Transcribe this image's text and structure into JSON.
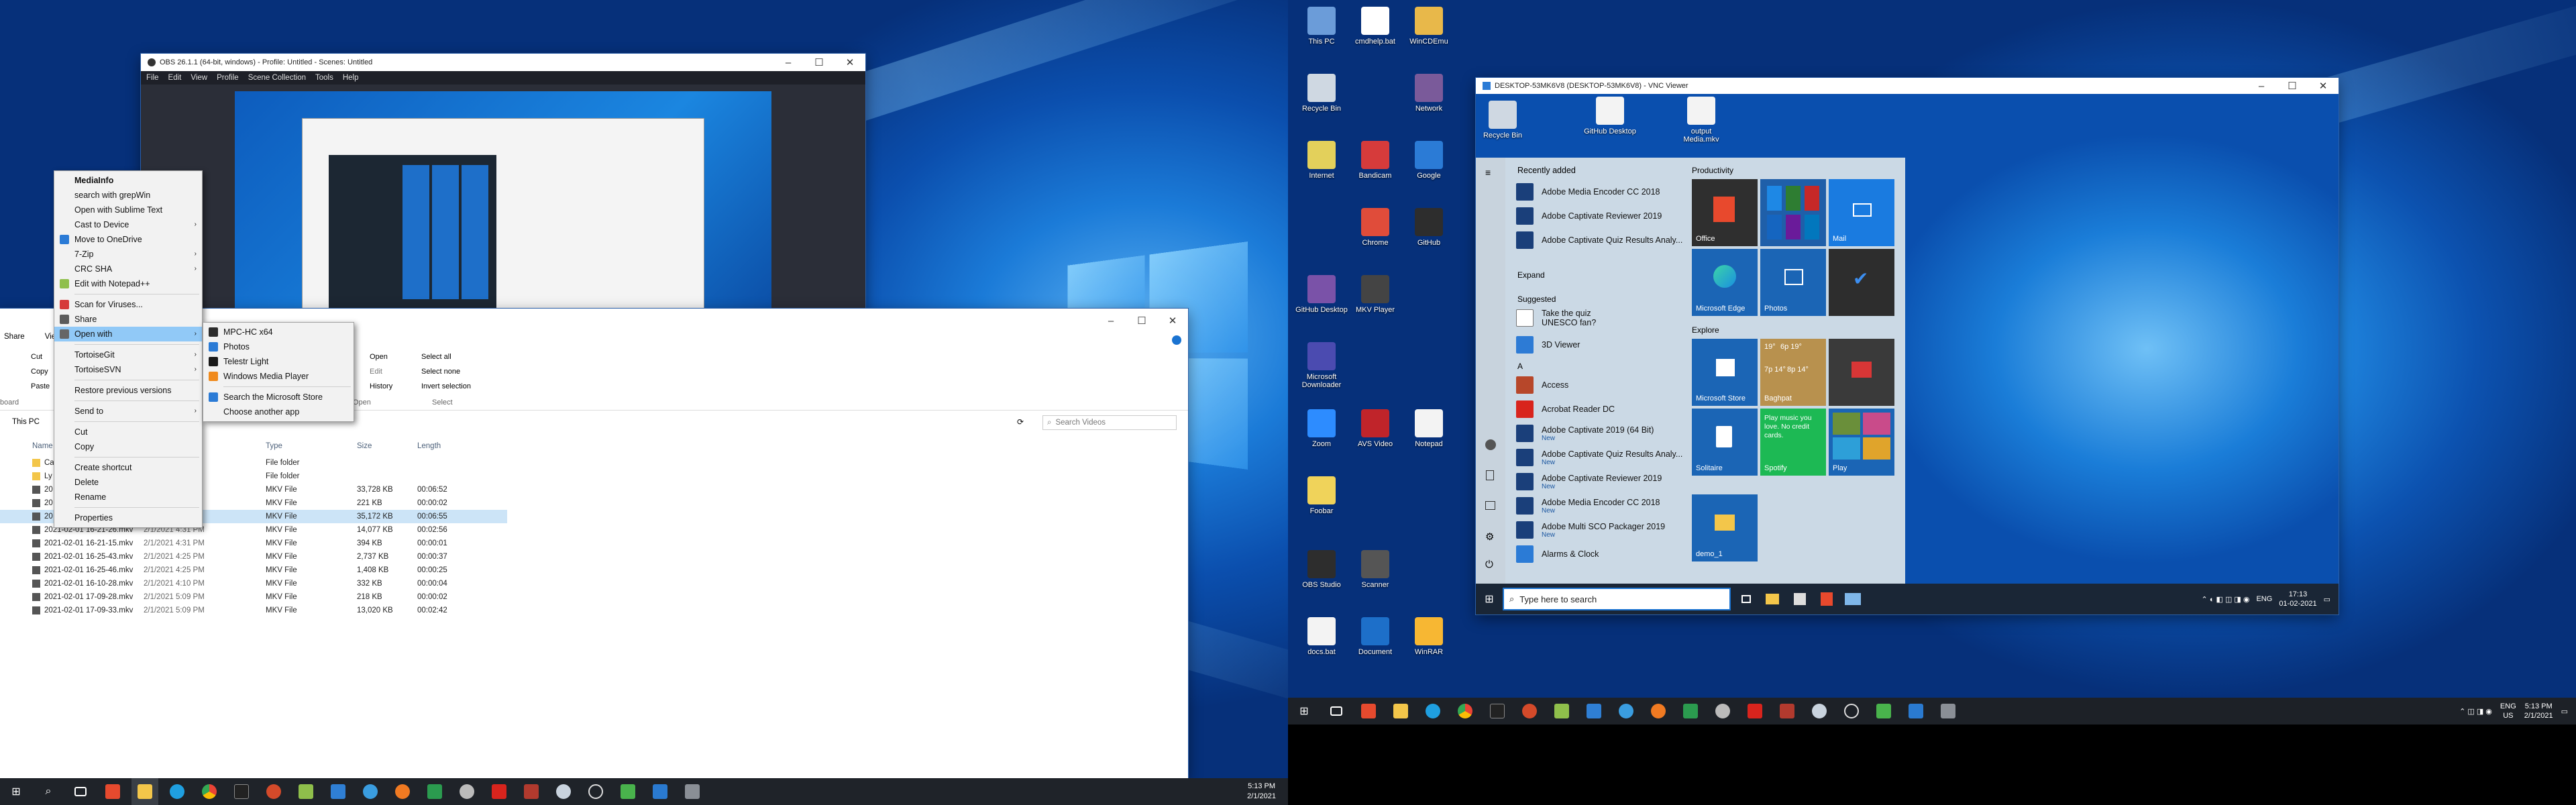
{
  "left": {
    "obs": {
      "title": "OBS 26.1.1 (64-bit, windows) - Profile: Untitled - Scenes: Untitled",
      "menu": [
        "File",
        "Edit",
        "View",
        "Profile",
        "Scene Collection",
        "Tools",
        "Help"
      ]
    },
    "context_menu": {
      "items": [
        {
          "label": "MediaInfo",
          "bold": true
        },
        {
          "label": "search with grepWin"
        },
        {
          "label": "Open with Sublime Text"
        },
        {
          "label": "Cast to Device",
          "arrow": true
        },
        {
          "label": "Move to OneDrive"
        },
        {
          "label": "7-Zip",
          "arrow": true
        },
        {
          "label": "CRC SHA",
          "arrow": true
        },
        {
          "label": "Edit with Notepad++"
        },
        {
          "sep": true
        },
        {
          "label": "Scan for Viruses..."
        },
        {
          "label": "Share"
        },
        {
          "label": "Open with",
          "arrow": true,
          "highlight": true
        },
        {
          "sep": true
        },
        {
          "label": "TortoiseGit",
          "arrow": true
        },
        {
          "label": "TortoiseSVN",
          "arrow": true
        },
        {
          "sep": true
        },
        {
          "label": "Restore previous versions"
        },
        {
          "sep": true
        },
        {
          "label": "Send to",
          "arrow": true
        },
        {
          "sep": true
        },
        {
          "label": "Cut"
        },
        {
          "label": "Copy"
        },
        {
          "sep": true
        },
        {
          "label": "Create shortcut"
        },
        {
          "label": "Delete"
        },
        {
          "label": "Rename"
        },
        {
          "sep": true
        },
        {
          "label": "Properties"
        }
      ]
    },
    "submenu": {
      "items": [
        "MPC-HC x64",
        "Photos",
        "Telestr Light",
        "Windows Media Player"
      ],
      "store": "Search the Microsoft Store",
      "another": "Choose another app"
    },
    "explorer": {
      "ribbon_left": [
        "Share",
        "View"
      ],
      "ribbon_small": [
        "Cut",
        "Copy",
        "Paste"
      ],
      "ribbon_open": [
        "Open",
        "Edit",
        "History"
      ],
      "ribbon_select": [
        "Select all",
        "Select none",
        "Invert selection"
      ],
      "group_open": "Open",
      "group_select": "Select",
      "group_board": "board",
      "address": "This PC",
      "search_placeholder": "Search Videos",
      "cols": {
        "name": "Name",
        "type": "Type",
        "size": "Size",
        "length": "Length"
      },
      "rows": [
        {
          "name": "Ca",
          "date": "PM",
          "type": "File folder",
          "size": "",
          "length": ""
        },
        {
          "name": "Ly",
          "date": "M",
          "type": "File folder",
          "size": "",
          "length": ""
        },
        {
          "name": "20",
          "date": "",
          "type": "MKV File",
          "size": "33,728 KB",
          "length": "00:06:52"
        },
        {
          "name": "20",
          "date": "",
          "type": "MKV File",
          "size": "221 KB",
          "length": "00:00:02"
        },
        {
          "name": "20",
          "date": "",
          "type": "MKV File",
          "size": "35,172 KB",
          "length": "00:06:55",
          "selected": true
        },
        {
          "name": "2021-02-01 16-21-26.mkv",
          "date": "2/1/2021 4:31 PM",
          "type": "MKV File",
          "size": "14,077 KB",
          "length": "00:02:56"
        },
        {
          "name": "2021-02-01 16-21-15.mkv",
          "date": "2/1/2021 4:31 PM",
          "type": "MKV File",
          "size": "394 KB",
          "length": "00:00:01"
        },
        {
          "name": "2021-02-01 16-25-43.mkv",
          "date": "2/1/2021 4:25 PM",
          "type": "MKV File",
          "size": "2,737 KB",
          "length": "00:00:37"
        },
        {
          "name": "2021-02-01 16-25-46.mkv",
          "date": "2/1/2021 4:25 PM",
          "type": "MKV File",
          "size": "1,408 KB",
          "length": "00:00:25"
        },
        {
          "name": "2021-02-01 16-10-28.mkv",
          "date": "2/1/2021 4:10 PM",
          "type": "MKV File",
          "size": "332 KB",
          "length": "00:00:04"
        },
        {
          "name": "2021-02-01 17-09-28.mkv",
          "date": "2/1/2021 5:09 PM",
          "type": "MKV File",
          "size": "218 KB",
          "length": "00:00:02"
        },
        {
          "name": "2021-02-01 17-09-33.mkv",
          "date": "2/1/2021 5:09 PM",
          "type": "MKV File",
          "size": "13,020 KB",
          "length": "00:02:42"
        }
      ]
    },
    "taskbar": {
      "time": "5:13 PM",
      "date": "2/1/2021"
    }
  },
  "right": {
    "desktop_icons": [
      "This PC",
      "cmdhelp.bat",
      "WinCDEmu",
      "Recycle Bin",
      "Bandicam",
      "Internet",
      "Network",
      "Chrome",
      "Google",
      "GitHub Desktop",
      "MKV Player",
      "GitHub",
      "Microsoft Downloader",
      "Zoom",
      "Foobar",
      "AVS Video",
      "Notepad",
      "OBS Studio",
      "Scanner",
      "docs.bat",
      "Document",
      "WinRAR"
    ],
    "vnc": {
      "title": "DESKTOP-53MK6V8 (DESKTOP-53MK6V8) - VNC Viewer"
    },
    "remote_icons": [
      "Recycle Bin",
      "GitHub Desktop",
      "output Media.mkv"
    ],
    "start": {
      "recently_added": "Recently added",
      "recent": [
        "Adobe Media Encoder CC 2018",
        "Adobe Captivate Reviewer 2019",
        "Adobe Captivate Quiz Results Analy..."
      ],
      "expand": "Expand",
      "suggested": "Suggested",
      "suggest_title": "Take the quiz",
      "suggest_sub": "UNESCO fan?",
      "viewer": "3D Viewer",
      "letter_a": "A",
      "apps": [
        {
          "name": "Access",
          "new": ""
        },
        {
          "name": "Acrobat Reader DC",
          "new": ""
        },
        {
          "name": "Adobe Captivate 2019 (64 Bit)",
          "new": "New"
        },
        {
          "name": "Adobe Captivate Quiz Results Analy...",
          "new": "New"
        },
        {
          "name": "Adobe Captivate Reviewer 2019",
          "new": "New"
        },
        {
          "name": "Adobe Media Encoder CC 2018",
          "new": "New"
        },
        {
          "name": "Adobe Multi SCO Packager 2019",
          "new": "New"
        },
        {
          "name": "Alarms & Clock",
          "new": ""
        }
      ],
      "productivity": "Productivity",
      "explore": "Explore",
      "tiles": {
        "office": "Office",
        "mail": "Mail",
        "edge": "Microsoft Edge",
        "photos": "Photos",
        "store": "Microsoft Store",
        "weather": "Baghpat",
        "weather_temps": [
          "19°",
          "6p 19°",
          "7p 14°",
          "8p 14°"
        ],
        "solitaire": "Solitaire",
        "spotify": "Spotify",
        "spotify_msg": "Play music you love. No credit cards.",
        "play": "Play",
        "demo": "demo_1"
      }
    },
    "vnc_taskbar": {
      "search": "Type here to search",
      "lang": "ENG",
      "time": "17:13",
      "date": "01-02-2021"
    },
    "taskbar": {
      "lang": "ENG",
      "region": "US",
      "time": "5:13 PM",
      "date": "2/1/2021"
    }
  }
}
